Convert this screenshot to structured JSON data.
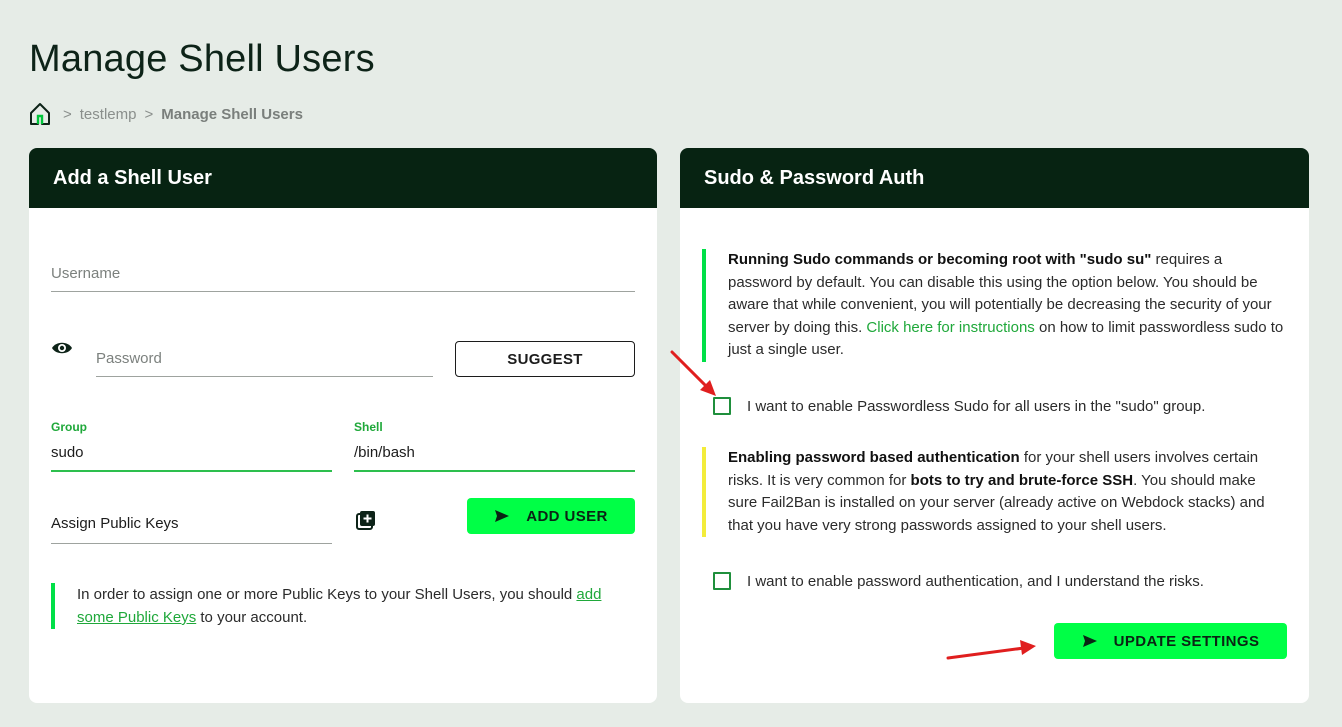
{
  "page": {
    "title": "Manage Shell Users"
  },
  "breadcrumb": {
    "items": [
      "testlemp",
      "Manage Shell Users"
    ],
    "separator": ">"
  },
  "add_user": {
    "header": "Add a Shell User",
    "username_placeholder": "Username",
    "password_placeholder": "Password",
    "suggest_label": "SUGGEST",
    "group_label": "Group",
    "group_value": "sudo",
    "shell_label": "Shell",
    "shell_value": "/bin/bash",
    "public_keys_label": "Assign Public Keys",
    "add_user_label": "ADD USER",
    "note_prefix": "In order to assign one or more Public Keys to your Shell Users, you should ",
    "note_link": "add some Public Keys",
    "note_suffix": " to your account."
  },
  "sudo_auth": {
    "header": "Sudo & Password Auth",
    "sudo_note_bold": "Running Sudo commands or becoming root with \"sudo su\"",
    "sudo_note_text": " requires a password by default. You can disable this using the option below. You should be aware that while convenient, you will potentially be decreasing the security of your server by doing this. ",
    "sudo_note_link": "Click here for instructions",
    "sudo_note_suffix": " on how to limit passwordless sudo to just a single user.",
    "passwordless_checkbox_label": "I want to enable Passwordless Sudo for all users in the \"sudo\" group.",
    "password_note_bold": "Enabling password based authentication",
    "password_note_text1": " for your shell users involves certain risks. It is very common for ",
    "password_note_bold2": "bots to try and brute-force SSH",
    "password_note_text2": ". You should make sure Fail2Ban is installed on your server (already active on Webdock stacks) and that you have very strong passwords assigned to your shell users.",
    "password_auth_checkbox_label": "I want to enable password authentication, and I understand the risks.",
    "update_label": "UPDATE SETTINGS"
  },
  "colors": {
    "header_bg": "#072312",
    "accent_green": "#00ff46",
    "note_green": "#00e048",
    "note_yellow": "#f3ec3a",
    "link_green": "#1fa83a",
    "arrow_red": "#e01e1e"
  }
}
